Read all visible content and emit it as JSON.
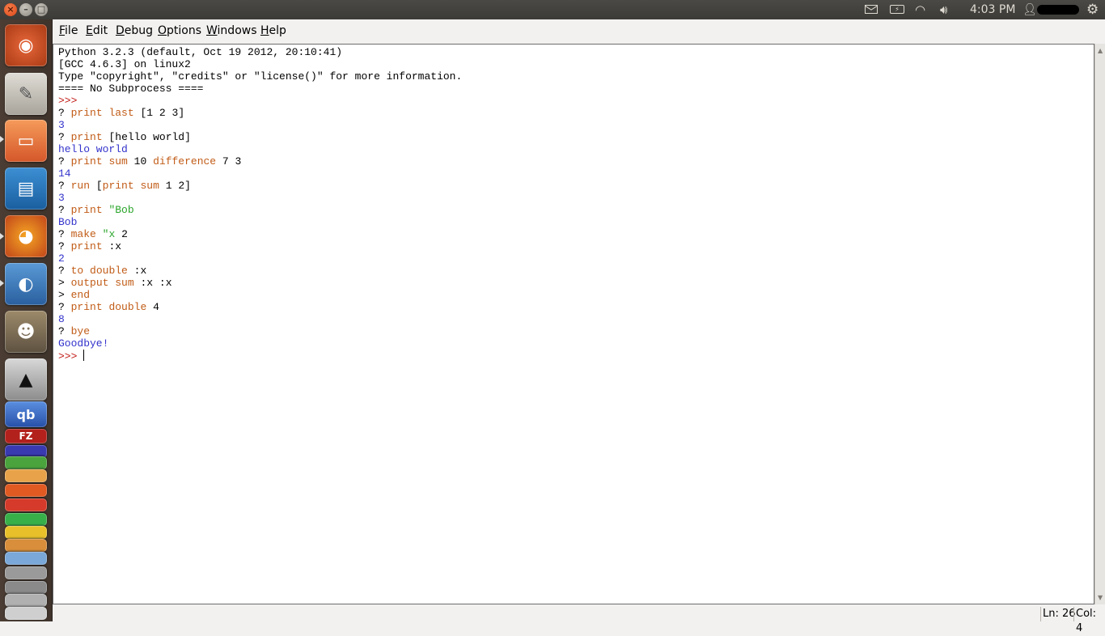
{
  "top_panel": {
    "clock": "4:03 PM",
    "icons": [
      "mail-icon",
      "battery-icon",
      "wifi-icon",
      "volume-icon",
      "user-icon",
      "settings-icon"
    ]
  },
  "launcher": {
    "items": [
      "ubuntu-logo-icon",
      "text-editor-icon",
      "files-icon",
      "writer-icon",
      "firefox-icon",
      "thunderbird-icon",
      "gimp-icon",
      "inkscape-icon",
      "qbittorrent-icon"
    ],
    "qb_label": "qb",
    "fz_label": "FZ"
  },
  "menu": {
    "file": {
      "m": "F",
      "rest": "ile"
    },
    "edit": {
      "m": "E",
      "rest": "dit"
    },
    "debug": {
      "m": "D",
      "rest": "ebug"
    },
    "options": {
      "m": "O",
      "rest": "ptions"
    },
    "windows": {
      "m": "W",
      "rest": "indows"
    },
    "help": {
      "m": "H",
      "rest": "elp"
    }
  },
  "editor": {
    "lines": [
      "Python 3.2.3 (default, Oct 19 2012, 20:10:41)",
      "[GCC 4.6.3] on linux2",
      "Type \"copyright\", \"credits\" or \"license()\" for more information.",
      "==== No Subprocess ====",
      ">>> ",
      "? print last [1 2 3]",
      "3",
      "? print [hello world]",
      "hello world",
      "? print sum 10 difference 7 3",
      "14",
      "? run [print sum 1 2]",
      "3",
      "? print \"Bob",
      "Bob",
      "? make \"x 2",
      "? print :x",
      "2",
      "? to double :x",
      "> output sum :x :x",
      "> end",
      "? print double 4",
      "8",
      "? bye",
      "Goodbye!",
      ">>> "
    ]
  },
  "status": {
    "ln": "Ln: 26",
    "col": "Col: 4"
  },
  "colors": {
    "keyword": "#c15c17",
    "builtin": "#900090",
    "output": "#3333cc",
    "string": "#2aa52a",
    "prompt": "#c11b17"
  }
}
